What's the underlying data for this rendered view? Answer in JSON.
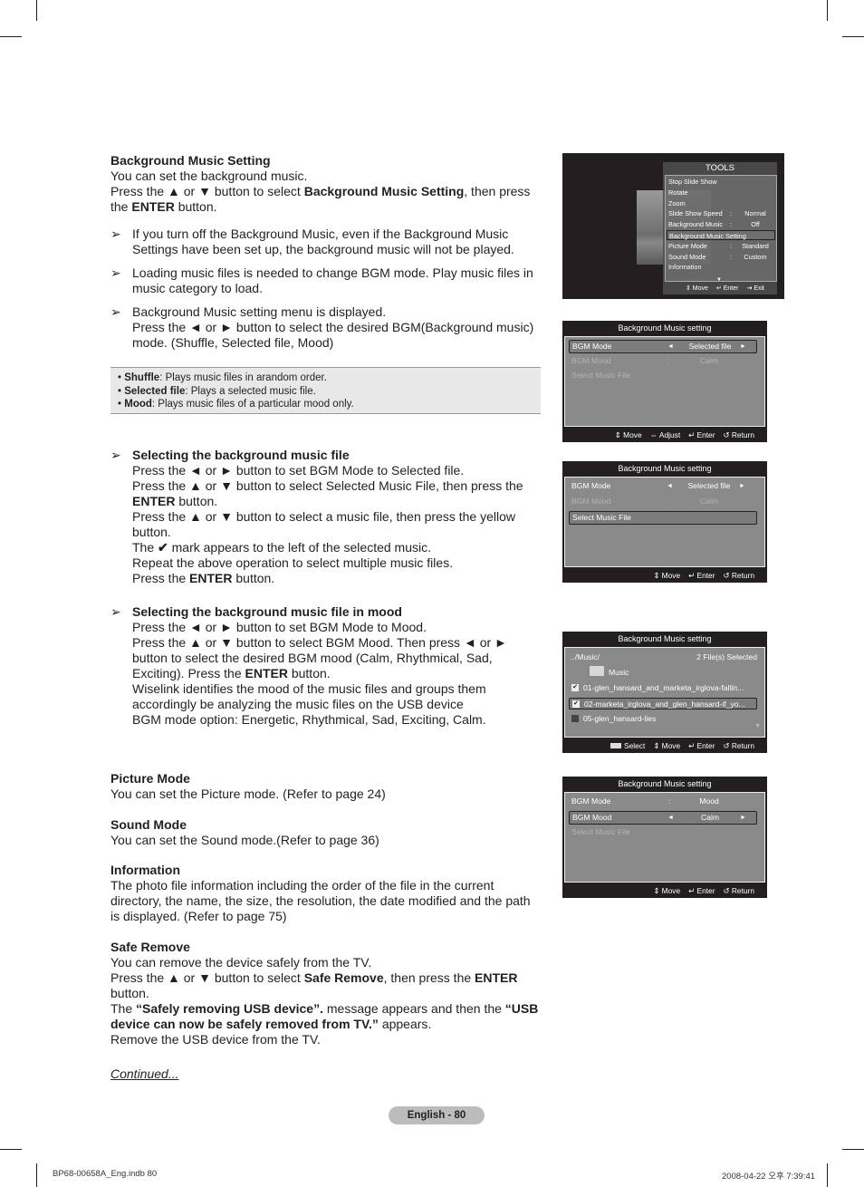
{
  "sections": {
    "bgm": {
      "title": "Background Music Setting",
      "lines": [
        "You can set the background music.",
        "Press the ▲ or ▼ button to select ",
        "Background Music Setting",
        ", then press the ",
        "ENTER",
        " button."
      ],
      "notes": [
        "If you turn off the Background Music, even if the Background Music Settings have been set up, the background music will not be played.",
        "Loading music files is needed to change BGM mode. Play music files in music category to load.",
        "Background Music setting menu is displayed."
      ],
      "note3_extra": "Press the ◄ or ► button to select the desired BGM(Background music) mode. (Shuffle, Selected file, Mood)"
    },
    "options_box": [
      {
        "term": "Shuffle",
        "desc": ": Plays music files in arandom order."
      },
      {
        "term": "Selected file",
        "desc": ": Plays a selected music file."
      },
      {
        "term": "Mood",
        "desc": ": Plays music files of a particular mood only."
      }
    ],
    "select_file": {
      "title": "Selecting the background music file",
      "l1": "Press the ◄ or ► button to set BGM Mode to Selected file.",
      "l2a": "Press the ▲ or ▼ button to select Selected Music File, then press the ",
      "l2b": "ENTER",
      "l2c": " button.",
      "l3": "Press the ▲ or ▼ button to select a music file, then press the yellow button.",
      "l4a": "The ",
      "l4check": "✔",
      "l4b": " mark appears to the left of the selected music.",
      "l5": "Repeat the above operation to select multiple music files.",
      "l6a": "Press the ",
      "l6b": "ENTER",
      "l6c": " button."
    },
    "select_mood": {
      "title": "Selecting the background music file in mood",
      "l1": "Press the ◄ or ► button to set BGM Mode to Mood.",
      "l2": "Press the ▲ or ▼ button to select BGM Mood. Then press ◄ or ► button to select the desired BGM mood (Calm, Rhythmical, Sad, Exciting). Press the ",
      "l2b": "ENTER",
      "l2c": " button.",
      "l3": "Wiselink identifies the mood of the music files and groups them accordingly be analyzing the music files on the USB device",
      "l4": "BGM mode option: Energetic, Rhythmical, Sad, Exciting, Calm."
    },
    "picture": {
      "title": "Picture Mode",
      "text": "You can set the Picture mode. (Refer to page 24)"
    },
    "sound": {
      "title": "Sound Mode",
      "text": "You can set the Sound mode.(Refer to page 36)"
    },
    "info": {
      "title": "Information",
      "text": "The photo file information including the order of the file in the current directory, the name, the size, the resolution, the date modified and the path is displayed. (Refer to page 75)"
    },
    "safe": {
      "title": "Safe Remove",
      "l1": "You can remove the device safely from the TV.",
      "l2a": "Press the ▲ or ▼ button to select ",
      "l2b": "Safe Remove",
      "l2c": ", then press the ",
      "l2d": "ENTER",
      "l2e": " button.",
      "l3a": "The ",
      "l3b": "“Safely removing USB device”.",
      "l3c": " message appears and then the ",
      "l3d": "“USB device can now be safely removed from TV.”",
      "l3e": " appears.",
      "l4": "Remove the USB device from the TV."
    },
    "continued": "Continued..."
  },
  "tools_menu": {
    "title": "TOOLS",
    "items": [
      {
        "label": "Stop Slide Show",
        "value": ""
      },
      {
        "label": "Rotate",
        "value": ""
      },
      {
        "label": "Zoom",
        "value": ""
      },
      {
        "label": "Slide Show Speed",
        "value": "Normal"
      },
      {
        "label": "Background Music",
        "value": "Off"
      },
      {
        "label": "Background Music Setting",
        "value": "",
        "selected": true
      },
      {
        "label": "Picture Mode",
        "value": "Standard"
      },
      {
        "label": "Sound Mode",
        "value": "Custom"
      },
      {
        "label": "Information",
        "value": ""
      }
    ],
    "footer": [
      "⇕ Move",
      "↵ Enter",
      "Exit"
    ]
  },
  "bgm_screens": {
    "title": "Background Music setting",
    "s1": {
      "mode_label": "BGM Mode",
      "mode_value": "Selected file",
      "mood_label": "BGM Mood",
      "mood_value": "Calm",
      "file_label": "Select Music File",
      "footer": [
        "⇕ Move",
        "⇔ Adjust",
        "↵ Enter",
        "↺ Return"
      ]
    },
    "s2": {
      "mode_label": "BGM Mode",
      "mode_value": "Selected file",
      "mood_label": "BGM Mood",
      "mood_value": "Calm",
      "file_label": "Select Music File",
      "footer": [
        "⇕ Move",
        "↵ Enter",
        "↺ Return"
      ]
    },
    "s3": {
      "path": "../Music/",
      "count": "2 File(s) Selected",
      "folder": "Music",
      "files": [
        {
          "name": "01-glen_hansard_and_marketa_irglova-fallin...",
          "checked": true
        },
        {
          "name": "02-marketa_irglova_and_glen_hansard-if_yo...",
          "checked": true
        },
        {
          "name": "05-glen_hansard-lies",
          "checked": false
        }
      ],
      "footer": [
        "Select",
        "⇕ Move",
        "↵ Enter",
        "↺ Return"
      ]
    },
    "s4": {
      "mode_label": "BGM Mode",
      "mode_value": "Mood",
      "mood_label": "BGM Mood",
      "mood_value": "Calm",
      "file_label": "Select Music File",
      "footer": [
        "⇕ Move",
        "↵ Enter",
        "↺ Return"
      ]
    }
  },
  "footer": {
    "page_badge": "English - 80",
    "file": "BP68-00658A_Eng.indb   80",
    "timestamp": "2008-04-22   오후 7:39:41"
  }
}
